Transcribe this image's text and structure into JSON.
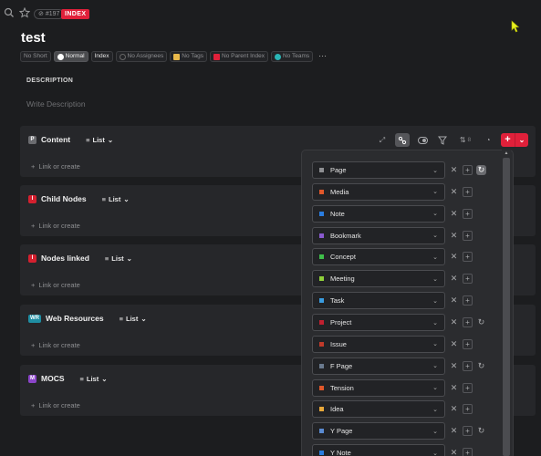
{
  "header": {
    "id_pill": "#197",
    "badge": "INDEX",
    "title": "test"
  },
  "chips": [
    {
      "label": "No Short",
      "style": "plain-muted",
      "dot": null
    },
    {
      "label": "Normal",
      "style": "active",
      "dot": "#ffffff"
    },
    {
      "label": "Index",
      "style": "plain",
      "dot": null
    },
    {
      "label": "No Assignees",
      "style": "muted",
      "dot": "#444548"
    },
    {
      "label": "No Tags",
      "style": "muted",
      "dot": "#e8b84a"
    },
    {
      "label": "No Parent Index",
      "style": "muted",
      "dot": "#e0203a"
    },
    {
      "label": "No Teams",
      "style": "muted",
      "dot": "#2ab5b5"
    }
  ],
  "more": "···",
  "description": {
    "label": "DESCRIPTION",
    "placeholder": "Write Description"
  },
  "sections": [
    {
      "icon": "P",
      "icon_color": "#6b6c70",
      "title": "Content",
      "view": "List",
      "add": "Link or create",
      "toolbar": true
    },
    {
      "icon": "I",
      "icon_color": "#d4202f",
      "title": "Child Nodes",
      "view": "List",
      "add": "Link or create"
    },
    {
      "icon": "I",
      "icon_color": "#d4202f",
      "title": "Nodes linked",
      "view": "List",
      "add": "Link or create"
    },
    {
      "icon": "WR",
      "icon_color": "#1f8ea3",
      "title": "Web Resources",
      "view": "List",
      "add": "Link or create"
    },
    {
      "icon": "M",
      "icon_color": "#8b45c9",
      "title": "MOCS",
      "view": "List",
      "add": "Link or create"
    }
  ],
  "toolbar": {
    "sort_count": "8"
  },
  "dropdown": {
    "rows": [
      {
        "label": "Page",
        "color": "#8e8f92",
        "extra": "highlight"
      },
      {
        "label": "Media",
        "color": "#e0572a",
        "extra": null
      },
      {
        "label": "Note",
        "color": "#2a7de0",
        "extra": null
      },
      {
        "label": "Bookmark",
        "color": "#8a5ad0",
        "extra": null
      },
      {
        "label": "Concept",
        "color": "#3fbf4a",
        "extra": null
      },
      {
        "label": "Meeting",
        "color": "#8fd03a",
        "extra": null
      },
      {
        "label": "Task",
        "color": "#3a9ce0",
        "extra": null
      },
      {
        "label": "Project",
        "color": "#c02030",
        "extra": "refresh"
      },
      {
        "label": "Issue",
        "color": "#c03a2a",
        "extra": null
      },
      {
        "label": "F Page",
        "color": "#6a7a8e",
        "extra": "refresh"
      },
      {
        "label": "Tension",
        "color": "#e0572a",
        "extra": null
      },
      {
        "label": "Idea",
        "color": "#e8a83a",
        "extra": null
      },
      {
        "label": "Y Page",
        "color": "#5a8ad0",
        "extra": "refresh"
      },
      {
        "label": "Y Note",
        "color": "#2a7de0",
        "extra": null
      }
    ]
  }
}
